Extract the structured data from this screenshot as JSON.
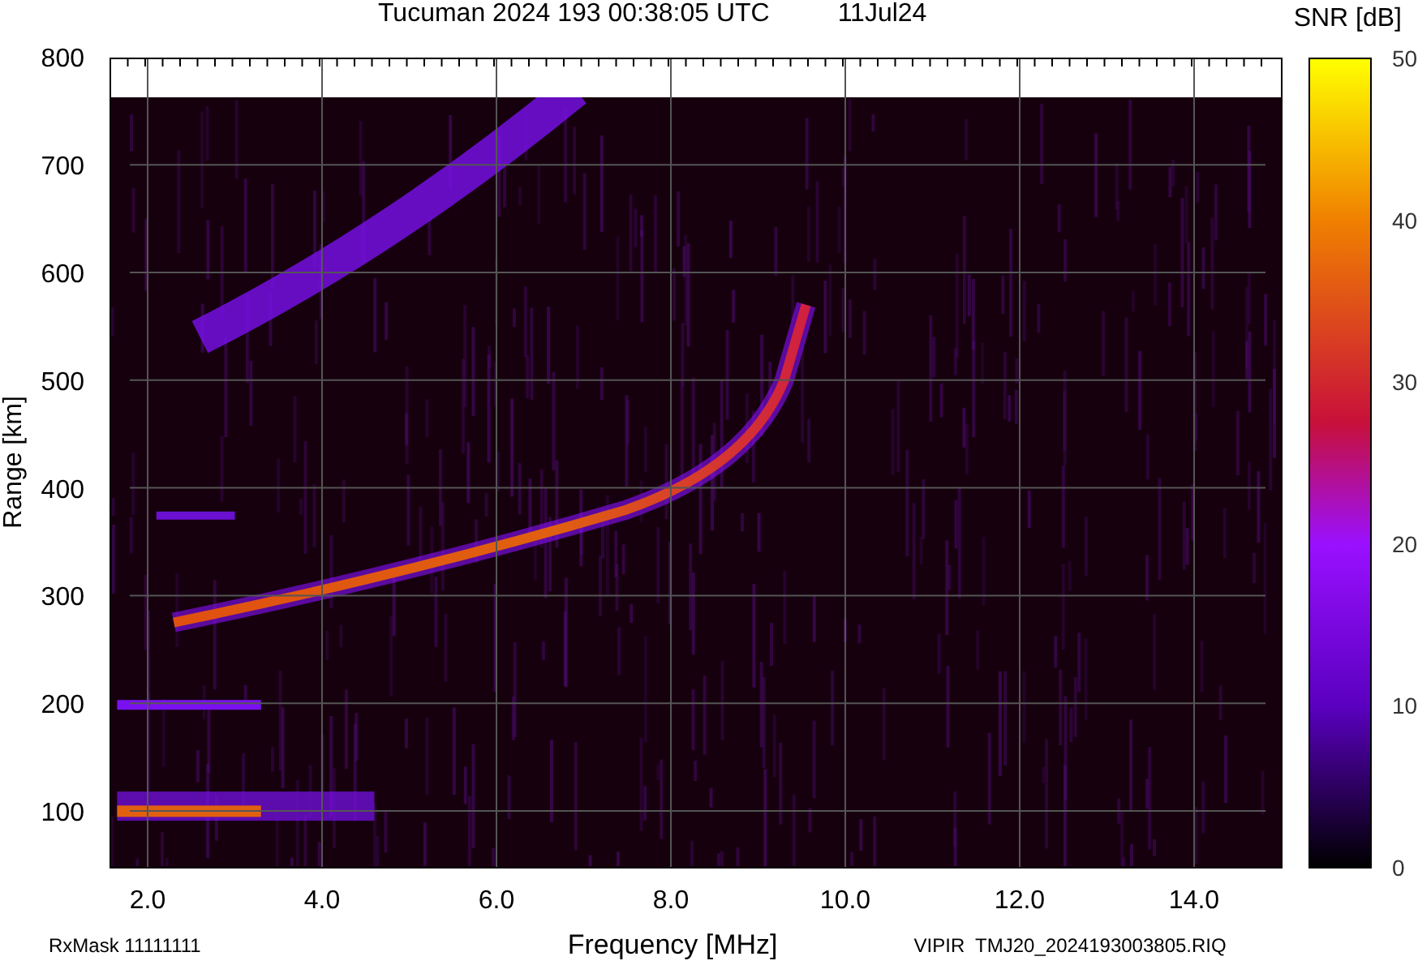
{
  "header": {
    "title": "Tucuman 2024 193 00:38:05 UTC",
    "date": "11Jul24",
    "colorbar_title": "SNR [dB]"
  },
  "plot": {
    "ylabel": "Range [km]",
    "xlabel": "Frequency [MHz]",
    "yticks": [
      "800",
      "700",
      "600",
      "500",
      "400",
      "300",
      "200",
      "100"
    ],
    "xticks": [
      "2.0",
      "4.0",
      "6.0",
      "8.0",
      "10.0",
      "12.0",
      "14.0"
    ],
    "colorbar_ticks": [
      "50",
      "40",
      "30",
      "20",
      "10",
      "0"
    ]
  },
  "footer": {
    "left": "RxMask 11111111",
    "right": "VIPIR  TMJ20_2024193003805.RIQ"
  }
}
